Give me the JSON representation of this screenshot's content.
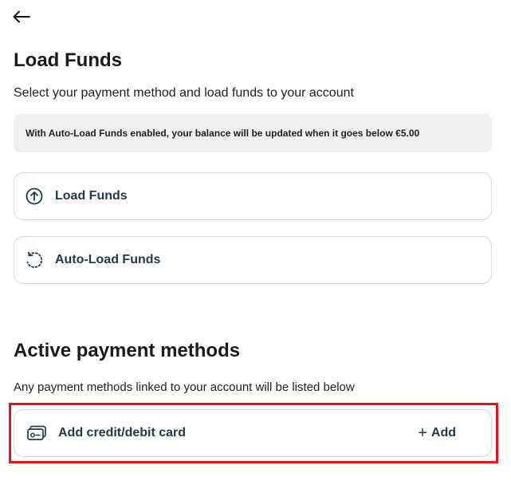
{
  "header": {
    "back_icon": "arrow-left-icon",
    "title": "Load Funds",
    "subtitle": "Select your payment method and load funds to your account"
  },
  "info_banner": {
    "text": "With Auto-Load Funds enabled, your balance will be updated when it goes below €5.00"
  },
  "options": [
    {
      "label": "Load Funds",
      "icon": "arrow-up-circle-icon"
    },
    {
      "label": "Auto-Load Funds",
      "icon": "refresh-dotted-icon"
    }
  ],
  "payment_methods": {
    "title": "Active payment methods",
    "subtitle": "Any payment methods linked to your account will be listed below",
    "add_card": {
      "label": "Add credit/debit card",
      "icon": "credit-card-icon",
      "action_label": "Add",
      "action_icon": "plus-icon"
    }
  },
  "colors": {
    "text_dark": "#1a1a1a",
    "label": "#233a45",
    "banner_bg": "#eef0f2",
    "border": "#d6d9dc",
    "highlight": "#e3141d"
  }
}
